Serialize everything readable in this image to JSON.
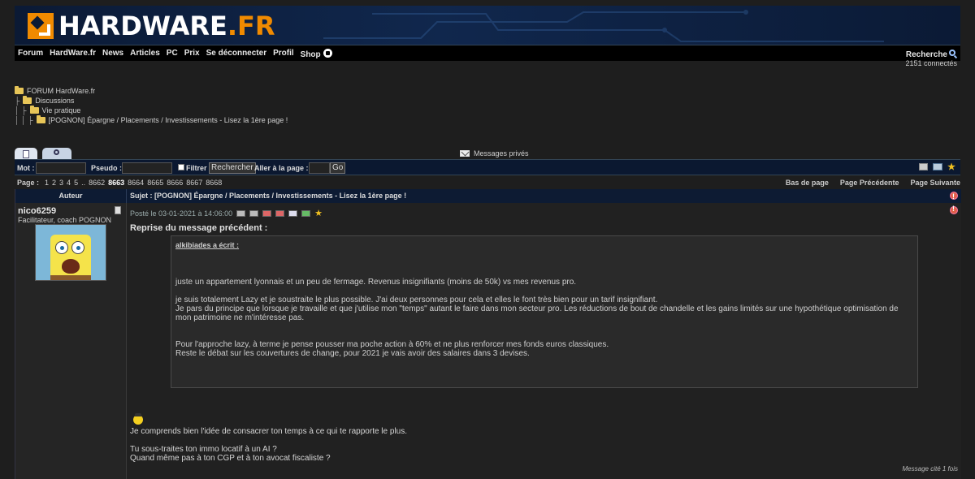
{
  "logo": {
    "text_main": "HARDWARE",
    "text_dot": ".FR"
  },
  "nav": {
    "items": [
      "Forum",
      "HardWare.fr",
      "News",
      "Articles",
      "PC",
      "Prix",
      "Se déconnecter",
      "Profil",
      "Shop"
    ],
    "search_label": "Recherche",
    "connected": "2151 connectés"
  },
  "breadcrumb": {
    "root": "FORUM HardWare.fr",
    "level1": "Discussions",
    "level2": "Vie pratique",
    "level3": "[POGNON] Épargne / Placements / Investissements - Lisez la 1ère page !"
  },
  "private_messages": "Messages privés",
  "searchbar": {
    "mot_label": "Mot :",
    "pseudo_label": "Pseudo :",
    "filter_label": "Filtrer",
    "search_button": "Rechercher",
    "goto_label": "Aller à la page :",
    "go_button": "Go"
  },
  "pagination": {
    "label": "Page :",
    "pages": [
      "1",
      "2",
      "3",
      "4",
      "5",
      "..",
      "8662",
      "8663",
      "8664",
      "8665",
      "8666",
      "8667",
      "8668"
    ],
    "current": "8663",
    "bottom": "Bas de page",
    "prev": "Page Précédente",
    "next": "Page Suivante"
  },
  "topic": {
    "author_header": "Auteur",
    "subject": "Sujet : [POGNON] Épargne / Placements / Investissements - Lisez la 1ère page !"
  },
  "post": {
    "author": "nico6259",
    "author_title": "Facilitateur, coach POGNON",
    "posted": "Posté le 03-01-2021 à 14:06:00",
    "reprise": "Reprise du message précédent :",
    "quote_author": "alkibiades a écrit :",
    "quote_paragraphs": [
      "juste un appartement lyonnais et un peu de fermage. Revenus insignifiants (moins de 50k) vs mes revenus pro.",
      "je suis totalement Lazy et je soustraite le plus possible. J'ai deux personnes pour cela et elles le font très bien pour un tarif insignifiant.\nJe pars du principe que lorsque je travaille et que j'utilise mon \"temps\" autant le faire dans mon secteur pro. Les réductions de bout de chandelle et les gains limités sur une hypothétique optimisation de mon patrimoine ne m'intéresse pas.",
      "Pour l'approche lazy, à terme je pense pousser ma poche action à 60% et ne plus renforcer mes fonds euros classiques.\nReste le débat sur les couvertures de change, pour 2021 je vais avoir des salaires dans 3 devises."
    ],
    "reply_paragraphs": [
      "Je comprends bien l'idée de consacrer ton temps à ce qui te rapporte le plus.",
      "Tu sous-traites ton immo locatif à un AI ?\nQuand même pas à ton CGP et à ton avocat fiscaliste ?"
    ],
    "cited": "Message cité 1 fois"
  }
}
